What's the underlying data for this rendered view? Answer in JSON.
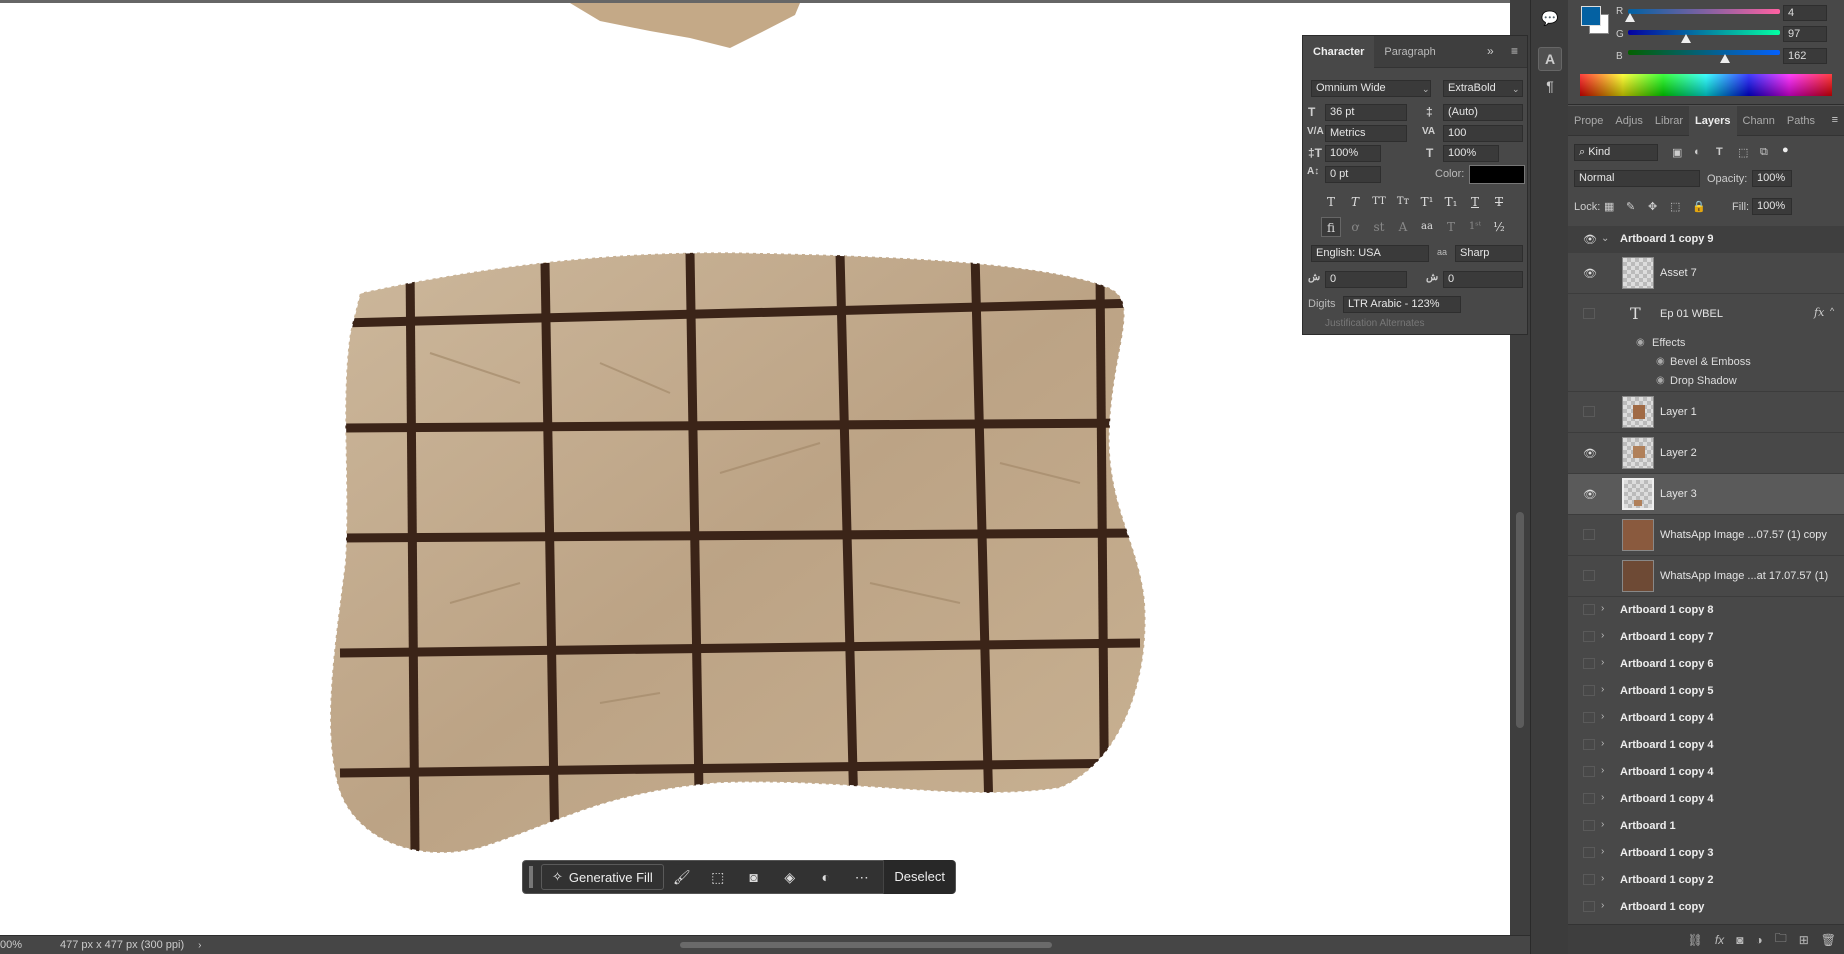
{
  "status": {
    "zoom": "00%",
    "dims": "477 px x 477 px (300 ppi)"
  },
  "character": {
    "tabs": [
      "Character",
      "Paragraph"
    ],
    "font_family": "Omnium Wide",
    "font_style": "ExtraBold",
    "size": "36 pt",
    "leading": "(Auto)",
    "kerning": "Metrics",
    "tracking": "100",
    "vscale": "100%",
    "hscale": "100%",
    "baseline": "0 pt",
    "color_label": "Color:",
    "color": "#000000",
    "language": "English: USA",
    "aa_label": "aa",
    "antialias": "Sharp",
    "kashida1": "0",
    "kashida2": "0",
    "digits_label": "Digits",
    "digits_value": "LTR Arabic - 123%",
    "justification": "Justification Alternates"
  },
  "color": {
    "r_label": "R",
    "g_label": "G",
    "b_label": "B",
    "r": "4",
    "g": "97",
    "b": "162",
    "r_level": 0.016,
    "g_level": 0.38,
    "b_level": 0.635,
    "fg": "#0461a2"
  },
  "layers_panel": {
    "tabs": [
      "Prope",
      "Adjus",
      "Librar",
      "Layers",
      "Chann",
      "Paths"
    ],
    "filter_kind": "Kind",
    "blend_mode": "Normal",
    "opacity_label": "Opacity:",
    "opacity": "100%",
    "lock_label": "Lock:",
    "fill_label": "Fill:",
    "fill": "100%",
    "artboard_open": "Artboard 1 copy 9",
    "asset7": "Asset 7",
    "text_layer": "Ep 01 WBEL",
    "effects": "Effects",
    "bevel": "Bevel & Emboss",
    "drop_shadow": "Drop Shadow",
    "layer1": "Layer 1",
    "layer2": "Layer 2",
    "layer3": "Layer 3",
    "wa1": "WhatsApp Image ...07.57 (1) copy",
    "wa2": "WhatsApp Image ...at 17.07.57 (1)",
    "artboards": [
      "Artboard 1 copy 8",
      "Artboard 1 copy 7",
      "Artboard 1 copy 6",
      "Artboard 1 copy 5",
      "Artboard 1 copy 4",
      "Artboard 1 copy 4",
      "Artboard 1 copy 4",
      "Artboard 1 copy 4",
      "Artboard 1",
      "Artboard 1 copy 3",
      "Artboard 1 copy 2",
      "Artboard 1 copy"
    ]
  },
  "context_bar": {
    "generative_fill": "Generative Fill",
    "deselect": "Deselect"
  }
}
